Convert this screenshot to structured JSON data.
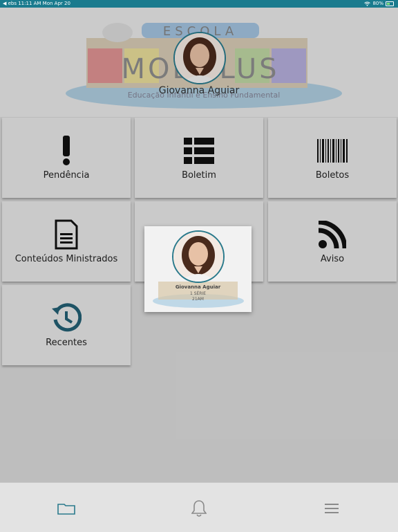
{
  "status_bar": {
    "left": "◀ ebs   11:11 AM   Mon Apr 20",
    "right": "80%",
    "wifi_icon": "wifi-icon",
    "battery_icon": "battery-icon"
  },
  "header": {
    "logo_lines": [
      "ESCOLA",
      "MODULUS",
      "Educação Infantil e Ensino Fundamental"
    ],
    "user_name": "Giovanna Aguiar"
  },
  "tiles": [
    {
      "label": "Pendência",
      "icon": "exclamation-icon"
    },
    {
      "label": "Boletim",
      "icon": "table-list-icon"
    },
    {
      "label": "Boletos",
      "icon": "barcode-icon"
    },
    {
      "label": "Conteúdos Ministrados",
      "icon": "document-icon"
    },
    {
      "label": "",
      "icon": "hidden-icon"
    },
    {
      "label": "Aviso",
      "icon": "rss-icon"
    },
    {
      "label": "Recentes",
      "icon": "history-icon"
    }
  ],
  "popup": {
    "name": "Giovanna Aguiar",
    "line1": "1 SÉRIE",
    "line2": "21AM"
  },
  "bottom_nav": {
    "items": [
      "folder-icon",
      "bell-icon",
      "menu-icon"
    ],
    "active_color": "#2a7a8c",
    "inactive_color": "#8a8a8a"
  }
}
